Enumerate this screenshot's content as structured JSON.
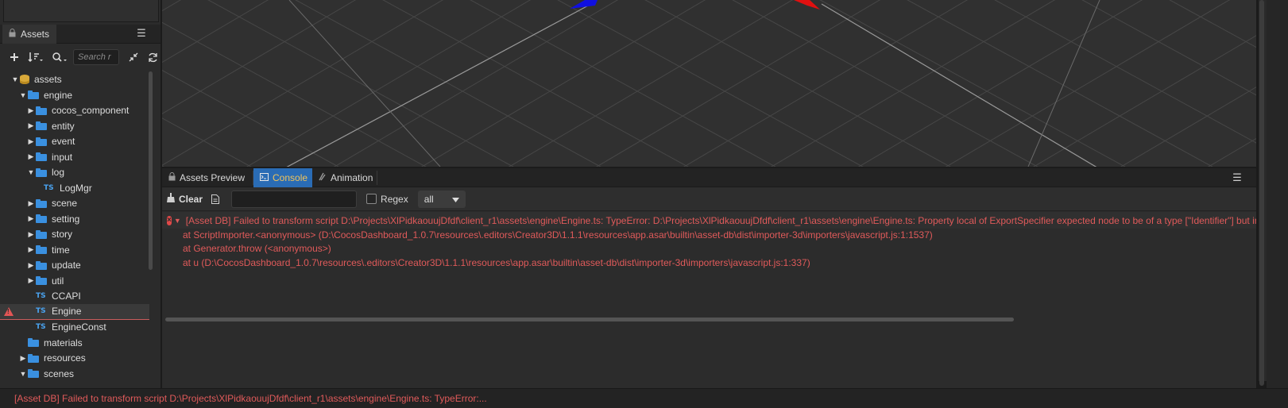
{
  "assets_panel": {
    "tab_label": "Assets",
    "search_placeholder": "Search r",
    "tree": [
      {
        "label": "assets",
        "type": "db",
        "depth": 0,
        "expanded": true
      },
      {
        "label": "engine",
        "type": "folder",
        "depth": 1,
        "expanded": true
      },
      {
        "label": "cocos_component",
        "type": "folder",
        "depth": 2,
        "expanded": false
      },
      {
        "label": "entity",
        "type": "folder",
        "depth": 2,
        "expanded": false
      },
      {
        "label": "event",
        "type": "folder",
        "depth": 2,
        "expanded": false
      },
      {
        "label": "input",
        "type": "folder",
        "depth": 2,
        "expanded": false
      },
      {
        "label": "log",
        "type": "folder",
        "depth": 2,
        "expanded": true
      },
      {
        "label": "LogMgr",
        "type": "ts",
        "depth": 3
      },
      {
        "label": "scene",
        "type": "folder",
        "depth": 2,
        "expanded": false
      },
      {
        "label": "setting",
        "type": "folder",
        "depth": 2,
        "expanded": false
      },
      {
        "label": "story",
        "type": "folder",
        "depth": 2,
        "expanded": false
      },
      {
        "label": "time",
        "type": "folder",
        "depth": 2,
        "expanded": false
      },
      {
        "label": "update",
        "type": "folder",
        "depth": 2,
        "expanded": false
      },
      {
        "label": "util",
        "type": "folder",
        "depth": 2,
        "expanded": false
      },
      {
        "label": "CCAPI",
        "type": "ts",
        "depth": 2
      },
      {
        "label": "Engine",
        "type": "ts",
        "depth": 2,
        "selected": true,
        "warning": true
      },
      {
        "label": "EngineConst",
        "type": "ts",
        "depth": 2
      },
      {
        "label": "materials",
        "type": "folder",
        "depth": 1
      },
      {
        "label": "resources",
        "type": "folder",
        "depth": 1,
        "expanded": false
      },
      {
        "label": "scenes",
        "type": "folder",
        "depth": 1,
        "expanded": true
      }
    ]
  },
  "console_panel": {
    "tabs": [
      {
        "label": "Assets Preview",
        "icon": "lock-icon",
        "active": false
      },
      {
        "label": "Console",
        "icon": "console-icon",
        "active": true
      },
      {
        "label": "Animation",
        "icon": "animation-icon",
        "active": false
      }
    ],
    "clear_label": "Clear",
    "filter_value": "",
    "regex_label": "Regex",
    "level_value": "all",
    "error_head": "[Asset DB] Failed to transform script D:\\Projects\\XlPidkaouujDfdf\\client_r1\\assets\\engine\\Engine.ts: TypeError: D:\\Projects\\XlPidkaouujDfdf\\client_r1\\assets\\engine\\Engine.ts: Property local of ExportSpecifier expected node to be of a type [\"Identifier\"] but ins",
    "stack": [
      "at ScriptImporter.<anonymous> (D:\\CocosDashboard_1.0.7\\resources\\.editors\\Creator3D\\1.1.1\\resources\\app.asar\\builtin\\asset-db\\dist\\importer-3d\\importers\\javascript.js:1:1537)",
      "at Generator.throw (<anonymous>)",
      "at u (D:\\CocosDashboard_1.0.7\\resources\\.editors\\Creator3D\\1.1.1\\resources\\app.asar\\builtin\\asset-db\\dist\\importer-3d\\importers\\javascript.js:1:337)"
    ]
  },
  "status_bar": {
    "message": "[Asset DB] Failed to transform script D:\\Projects\\XlPidkaouujDfdf\\client_r1\\assets\\engine\\Engine.ts: TypeError:..."
  },
  "colors": {
    "error": "#e05a5a",
    "accent": "#2a6cb5",
    "folder": "#3a90e0",
    "gizmo_x": "#e01010",
    "gizmo_z": "#1010e0"
  }
}
